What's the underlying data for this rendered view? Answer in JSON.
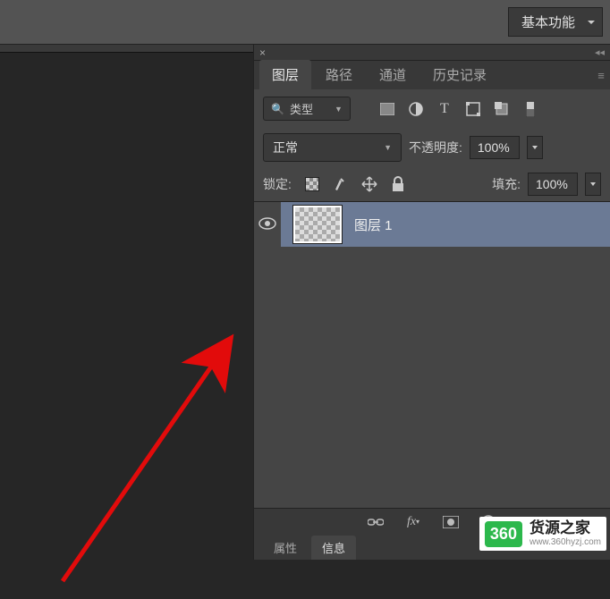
{
  "top": {
    "workspace": "基本功能"
  },
  "panel": {
    "tabs": [
      "图层",
      "路径",
      "通道",
      "历史记录"
    ],
    "filter_label": "类型",
    "blend_mode": "正常",
    "opacity_label": "不透明度:",
    "opacity_value": "100%",
    "lock_label": "锁定:",
    "fill_label": "填充:",
    "fill_value": "100%",
    "layer_name": "图层 1"
  },
  "bottom_tabs": [
    "属性",
    "信息"
  ],
  "watermark": {
    "badge": "360",
    "title": "货源之家",
    "url": "www.360hyzj.com"
  }
}
